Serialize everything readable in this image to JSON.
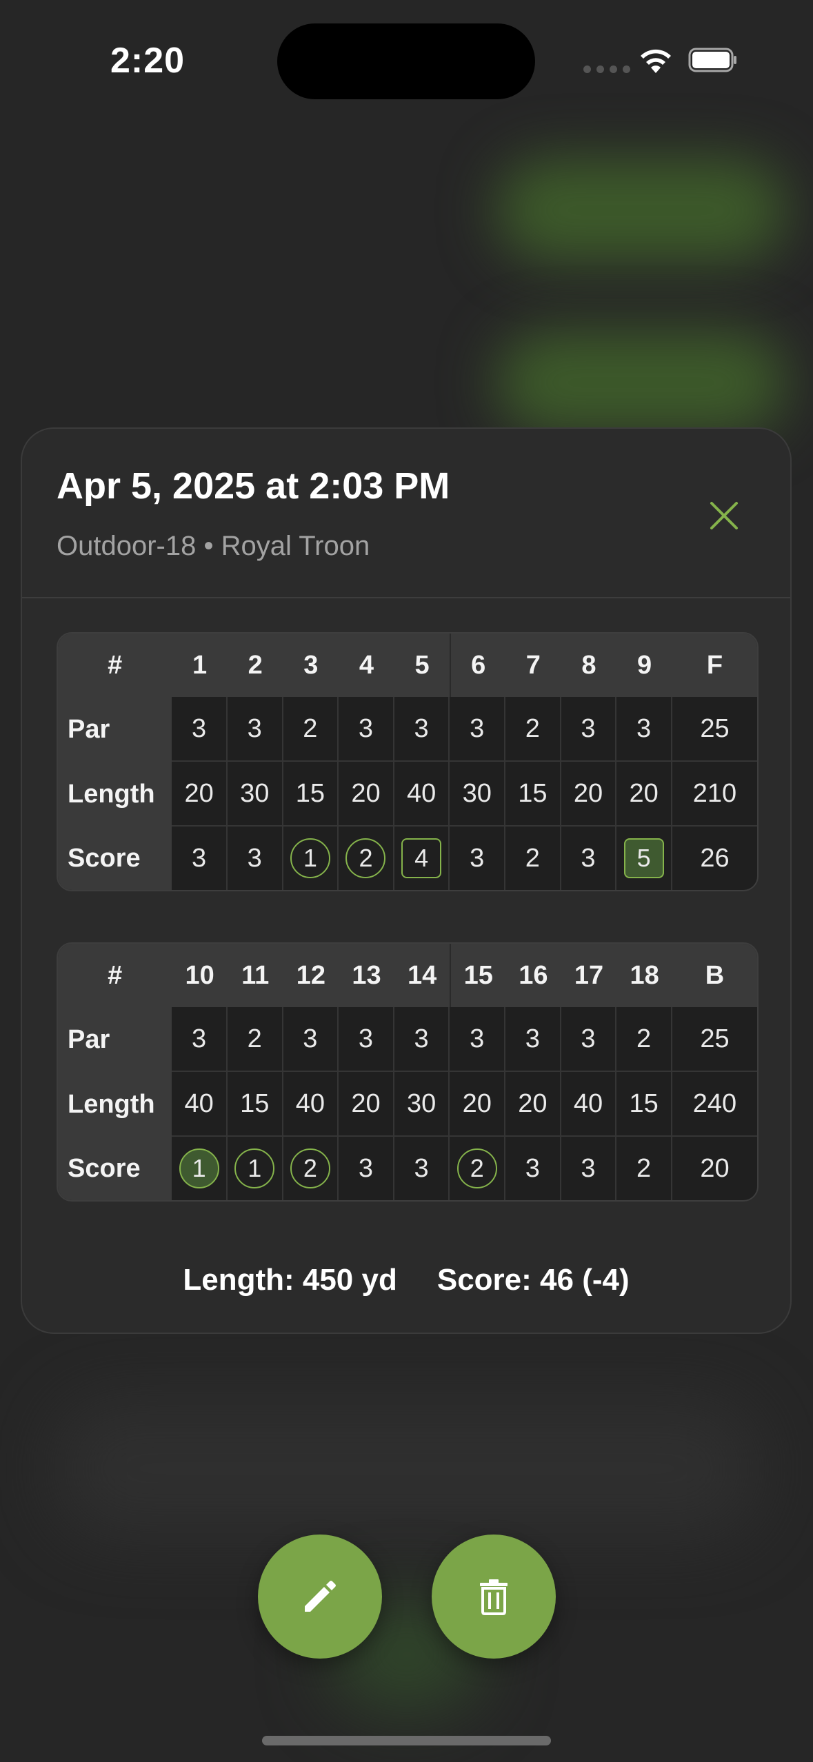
{
  "status": {
    "time": "2:20"
  },
  "sheet": {
    "title": "Apr 5, 2025 at 2:03 PM",
    "subtitle": "Outdoor-18 • Royal Troon",
    "close_icon": "close-x-icon"
  },
  "front": {
    "header": [
      "#",
      "1",
      "2",
      "3",
      "4",
      "5",
      "6",
      "7",
      "8",
      "9",
      "F"
    ],
    "par": {
      "label": "Par",
      "values": [
        "3",
        "3",
        "2",
        "3",
        "3",
        "3",
        "2",
        "3",
        "3",
        "25"
      ]
    },
    "length": {
      "label": "Length",
      "values": [
        "20",
        "30",
        "15",
        "20",
        "40",
        "30",
        "15",
        "20",
        "20",
        "210"
      ]
    },
    "score": {
      "label": "Score",
      "values": [
        "3",
        "3",
        "1",
        "2",
        "4",
        "3",
        "2",
        "3",
        "5",
        "26"
      ]
    }
  },
  "back": {
    "header": [
      "#",
      "10",
      "11",
      "12",
      "13",
      "14",
      "15",
      "16",
      "17",
      "18",
      "B"
    ],
    "par": {
      "label": "Par",
      "values": [
        "3",
        "2",
        "3",
        "3",
        "3",
        "3",
        "3",
        "3",
        "2",
        "25"
      ]
    },
    "length": {
      "label": "Length",
      "values": [
        "40",
        "15",
        "40",
        "20",
        "30",
        "20",
        "20",
        "40",
        "15",
        "240"
      ]
    },
    "score": {
      "label": "Score",
      "values": [
        "1",
        "1",
        "2",
        "3",
        "3",
        "2",
        "3",
        "3",
        "2",
        "20"
      ]
    }
  },
  "summary": {
    "length": "Length: 450 yd",
    "score": "Score: 46 (-4)"
  },
  "actions": {
    "edit_icon": "pencil-icon",
    "delete_icon": "trash-icon"
  },
  "colors": {
    "accent": "#7ba548",
    "background": "#262626",
    "card": "#2b2b2b"
  }
}
